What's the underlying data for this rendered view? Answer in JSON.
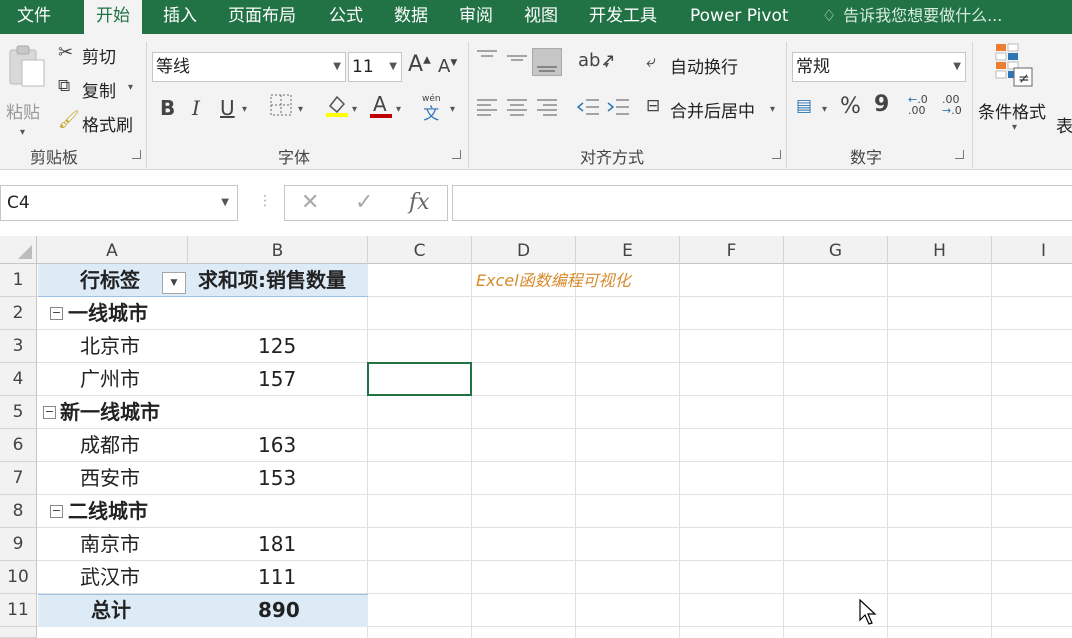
{
  "tabs": [
    "文件",
    "开始",
    "插入",
    "页面布局",
    "公式",
    "数据",
    "审阅",
    "视图",
    "开发工具",
    "Power Pivot"
  ],
  "tell_me": "告诉我您想要做什么...",
  "ribbon": {
    "clipboard": {
      "paste": "粘贴",
      "cut": "剪切",
      "copy": "复制",
      "format_painter": "格式刷",
      "group": "剪贴板"
    },
    "font": {
      "name": "等线",
      "size": "11",
      "group": "字体",
      "wen": "wén",
      "wen_char": "文"
    },
    "alignment": {
      "wrap": "自动换行",
      "merge": "合并后居中",
      "group": "对齐方式"
    },
    "number": {
      "format": "常规",
      "percent": "%",
      "comma": "9",
      "group": "数字"
    },
    "styles": {
      "conditional": "条件格式",
      "table": "表"
    }
  },
  "formula_bar": {
    "name_box": "C4",
    "fx": "fx"
  },
  "columns": [
    "A",
    "B",
    "C",
    "D",
    "E",
    "F",
    "G",
    "H",
    "I"
  ],
  "rows": [
    "1",
    "2",
    "3",
    "4",
    "5",
    "6",
    "7",
    "8",
    "9",
    "10",
    "11"
  ],
  "pivot": {
    "header_row_label": "行标签",
    "header_value": "求和项:销售数量",
    "groups": [
      {
        "name": "一线城市",
        "items": [
          {
            "city": "北京市",
            "value": "125"
          },
          {
            "city": "广州市",
            "value": "157"
          }
        ]
      },
      {
        "name": "新一线城市",
        "items": [
          {
            "city": "成都市",
            "value": "163"
          },
          {
            "city": "西安市",
            "value": "153"
          }
        ]
      },
      {
        "name": "二线城市",
        "items": [
          {
            "city": "南京市",
            "value": "181"
          },
          {
            "city": "武汉市",
            "value": "111"
          }
        ]
      }
    ],
    "total_label": "总计",
    "total_value": "890"
  },
  "note_text": "Excel函数编程可视化",
  "colors": {
    "accent": "#217346",
    "pivot_header": "#ddebf7",
    "note": "#d78a2a"
  }
}
